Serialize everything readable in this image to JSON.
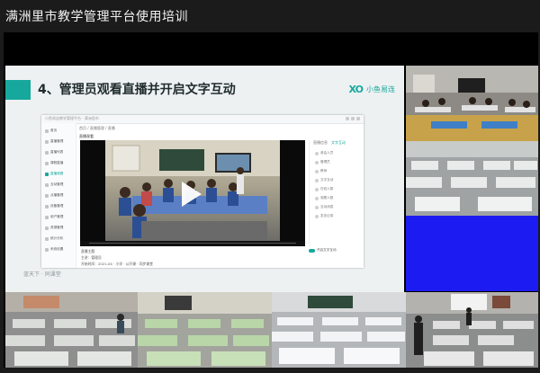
{
  "window": {
    "title": "满洲里市教学管理平台使用培训"
  },
  "slide": {
    "heading": "4、管理员观看直播并开启文字互动",
    "brand": {
      "logo": "XO",
      "name": "小鱼易连"
    },
    "footer_note": "蓝天下 · 同课堂"
  },
  "app": {
    "top_bar_text": "小鱼易连教学管理平台 · 满洲里市",
    "breadcrumb": "首页 / 直播管理 / 直播",
    "live_label": "直播观看",
    "sidebar": [
      {
        "label": "首页"
      },
      {
        "label": "直播管理"
      },
      {
        "label": "直播列表"
      },
      {
        "label": "课程直播"
      },
      {
        "label": "直播观看"
      },
      {
        "label": "互动管理"
      },
      {
        "label": "点播管理"
      },
      {
        "label": "设备管理"
      },
      {
        "label": "用户管理"
      },
      {
        "label": "资源管理"
      },
      {
        "label": "统计分析"
      },
      {
        "label": "系统设置"
      }
    ],
    "panel_tabs": [
      "直播信息",
      "文字互动"
    ],
    "panel_rows": [
      "参会人员",
      "管理员",
      "教师",
      "文字互动",
      "在线人数",
      "观看人数",
      "互动消息",
      "发言记录"
    ],
    "toggle_label": "开启文字互动",
    "info_lines": [
      "直播主题",
      "主讲：管理员",
      "开始时间：2021-04 · 小学 · 公开课 · 同步课堂"
    ]
  },
  "colors": {
    "accent": "#17a89d",
    "tile_blue": "#1c1cf2",
    "background": "#1b1b1b"
  }
}
